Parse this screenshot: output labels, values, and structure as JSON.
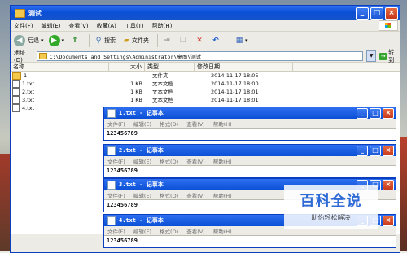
{
  "explorer": {
    "title": "测试",
    "menu": [
      "文件(F)",
      "编辑(E)",
      "查看(V)",
      "收藏(A)",
      "工具(T)",
      "帮助(H)"
    ],
    "toolbar": {
      "back": "后退",
      "search": "搜索",
      "folders": "文件夹"
    },
    "address_label": "地址(D)",
    "address_value": "C:\\Documents and Settings\\Administrator\\桌面\\测试",
    "go_label": "转到",
    "columns": [
      "名称",
      "大小",
      "类型",
      "修改日期"
    ],
    "rows": [
      {
        "name": "1",
        "size": "",
        "type": "文件夹",
        "date": "2014-11-17 18:05",
        "kind": "folder"
      },
      {
        "name": "1.txt",
        "size": "1 KB",
        "type": "文本文档",
        "date": "2014-11-17 18:00",
        "kind": "file"
      },
      {
        "name": "2.txt",
        "size": "1 KB",
        "type": "文本文档",
        "date": "2014-11-17 18:01",
        "kind": "file"
      },
      {
        "name": "3.txt",
        "size": "1 KB",
        "type": "文本文档",
        "date": "2014-11-17 18:01",
        "kind": "file"
      },
      {
        "name": "4.txt",
        "size": "",
        "type": "",
        "date": "",
        "kind": "file"
      }
    ]
  },
  "notepads": [
    {
      "title": "1.txt - 记事本",
      "content": "123456789"
    },
    {
      "title": "2.txt - 记事本",
      "content": "123456789"
    },
    {
      "title": "3.txt - 记事本",
      "content": "123456789"
    },
    {
      "title": "4.txt - 记事本",
      "content": "123456789"
    }
  ],
  "notepad_menu": [
    "文件(F)",
    "编辑(E)",
    "格式(O)",
    "查看(V)",
    "帮助(H)"
  ],
  "watermark": {
    "big": "百科全说",
    "small": "助你轻松解决"
  }
}
